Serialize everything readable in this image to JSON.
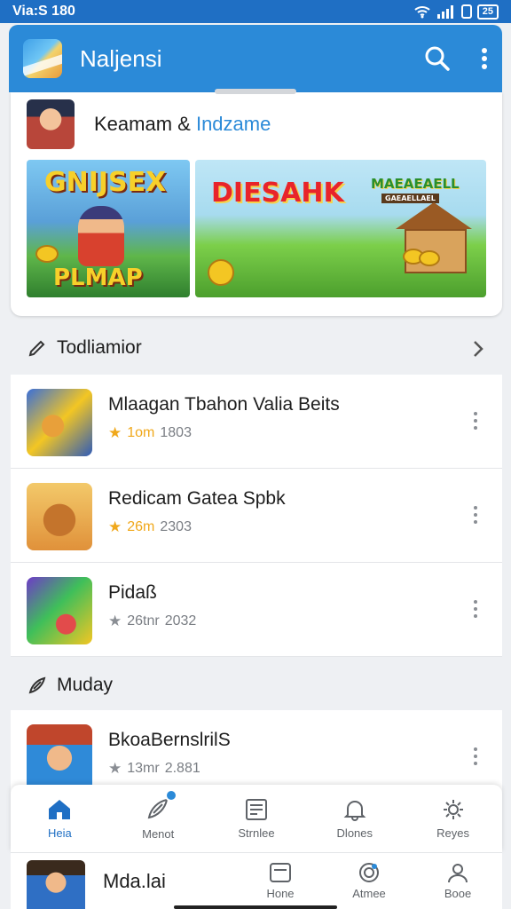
{
  "status_bar": {
    "time": "Via:S 180",
    "battery": "25"
  },
  "app_bar": {
    "title": "Naljensi"
  },
  "featured": {
    "title_main": "Keamam &",
    "title_accent": "Indzame",
    "banners": [
      {
        "top_text": "GNIJSEX",
        "bottom_text": "PLMAP"
      },
      {
        "left_text": "DIESAHK",
        "right_text": "MAEAEAELL",
        "sub_text": "GAEAELLAEL"
      }
    ]
  },
  "section_1": {
    "title": "Todliamior"
  },
  "list_1": [
    {
      "title": "Mlaagan Tbahon Valia Beits",
      "rating": "1om",
      "count": "1803",
      "rating_color": "#f0a81b"
    },
    {
      "title": "Redicam Gatea Spbk",
      "rating": "26m",
      "count": "2303",
      "rating_color": "#f0a81b"
    },
    {
      "title": "Pidaß",
      "rating": "26tnr",
      "count": "2032",
      "rating_color": "#8a8e94"
    }
  ],
  "section_2": {
    "title": "Muday"
  },
  "list_2": [
    {
      "title": "BkoaBernslrilS",
      "rating": "13mr",
      "count": "2.881",
      "rating_color": "#8a8e94"
    }
  ],
  "bottom_nav": [
    {
      "label": "Heia",
      "icon": "home-icon",
      "active": true
    },
    {
      "label": "Menot",
      "icon": "feather-icon",
      "active": false
    },
    {
      "label": "Strnlee",
      "icon": "newspaper-icon",
      "active": false
    },
    {
      "label": "Dlones",
      "icon": "bell-icon",
      "active": false
    },
    {
      "label": "Reyes",
      "icon": "gear-icon",
      "active": false
    }
  ],
  "mini_bar": {
    "title": "Mda.lai",
    "items": [
      {
        "label": "Hone",
        "icon": "window-icon"
      },
      {
        "label": "Atmee",
        "icon": "target-icon"
      },
      {
        "label": "Booe",
        "icon": "person-icon"
      }
    ]
  },
  "colors": {
    "primary": "#2b8ad8",
    "status_bar": "#1f6fc4",
    "star": "#f0a81b"
  }
}
